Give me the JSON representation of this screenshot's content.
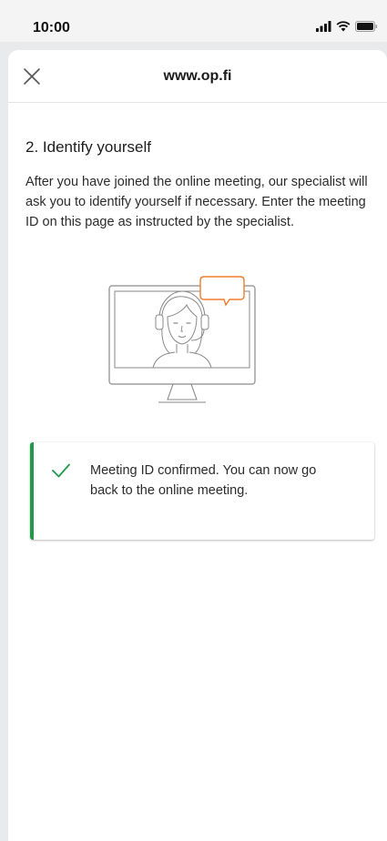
{
  "status_bar": {
    "time": "10:00"
  },
  "browser": {
    "url": "www.op.fi"
  },
  "content": {
    "heading": "2. Identify yourself",
    "body": "After you have joined the online meeting, our specialist will ask you to identify yourself if necessary. Enter the meeting ID on this page as instructed by the specialist."
  },
  "alert": {
    "message": "Meeting ID confirmed. You can now go back to the online meeting."
  },
  "colors": {
    "success": "#1f9a4b",
    "accent": "#f07c2e"
  }
}
